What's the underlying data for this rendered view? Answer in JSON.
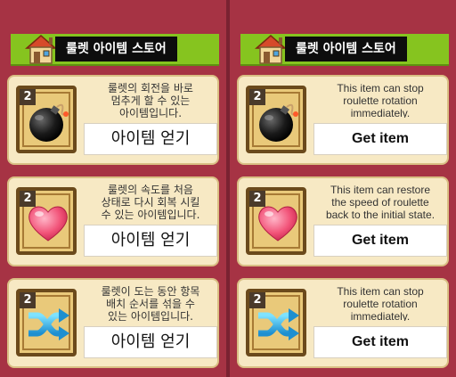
{
  "left": {
    "title": "룰렛 아이템 스토어",
    "items": [
      {
        "icon": "bomb-icon",
        "badge": "2",
        "description": "룰렛의 회전을 바로\n멈추게 할 수 있는\n아이템입니다.",
        "button": "아이템 얻기"
      },
      {
        "icon": "heart-icon",
        "badge": "2",
        "description": "룰렛의 속도를 처음\n상태로 다시 회복 시킬\n수 있는 아이템입니다.",
        "button": "아이템 얻기"
      },
      {
        "icon": "shuffle-icon",
        "badge": "2",
        "description": "룰렛이 도는 동안 항목\n배치 순서를 섞을 수\n있는 아이템입니다.",
        "button": "아이템 얻기"
      }
    ]
  },
  "right": {
    "title": "룰렛 아이템 스토어",
    "items": [
      {
        "icon": "bomb-icon",
        "badge": "2",
        "description": "This item can stop\nroulette rotation\nimmediately.",
        "button": "Get item"
      },
      {
        "icon": "heart-icon",
        "badge": "2",
        "description": "This item can restore\nthe speed of roulette\nback to the initial state.",
        "button": "Get item"
      },
      {
        "icon": "shuffle-icon",
        "badge": "2",
        "description": "This item can stop\nroulette rotation\nimmediately.",
        "button": "Get item"
      }
    ]
  }
}
